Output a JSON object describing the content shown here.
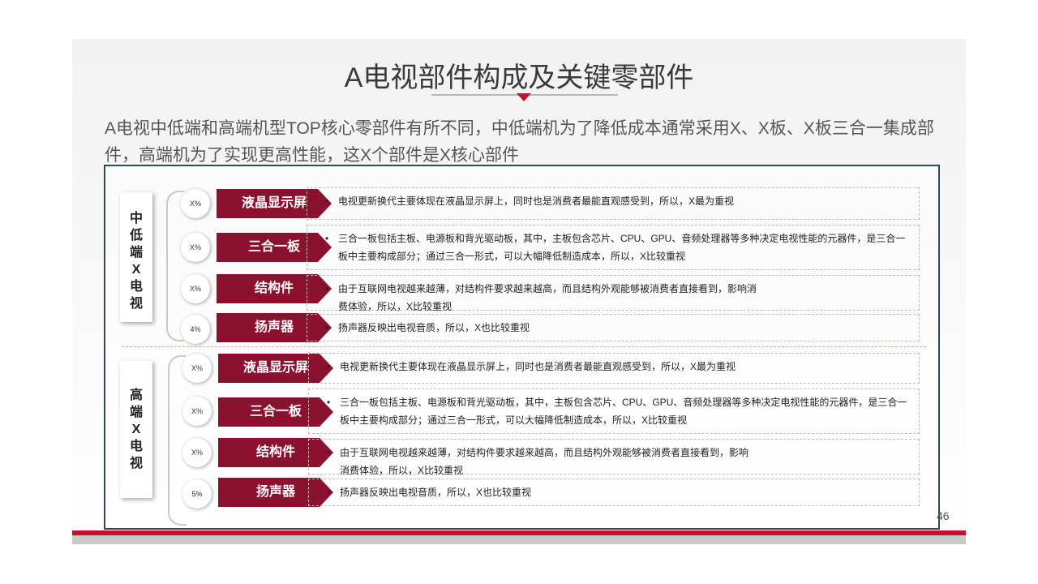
{
  "title": "A电视部件构成及关键零部件",
  "subtitle": "A电视中低端和高端机型TOP核心零部件有所不同，中低端机为了降低成本通常采用X、X板、X板三合一集成部件，高端机为了实现更高性能，这X个部件是X核心部件",
  "page_number": "46",
  "colors": {
    "accent": "#8c1030",
    "accent_bright": "#c8102e",
    "frame": "#2f4b53"
  },
  "groups": [
    {
      "label": "中低端X电视",
      "chars": [
        "中",
        "低",
        "端",
        "X",
        "电",
        "视"
      ],
      "rows": [
        {
          "pct": "X%",
          "label": "液晶显示屏",
          "bullet": "•",
          "text": "电视更新换代主要体现在液晶显示屏上，同时也是消费者最能直观感受到，所以，X最为重视"
        },
        {
          "pct": "X%",
          "label": "三合一板",
          "bullet": "•",
          "text": "三合一板包括主板、电源板和背光驱动板，其中，主板包含芯片、CPU、GPU、音频处理器等多种决定电视性能的元器件，是三合一板中主要构成部分；通过三合一形式，可以大幅降低制造成本，所以，X比较重视"
        },
        {
          "pct": "X%",
          "label": "结构件",
          "bullet": "•",
          "text": "由于互联网电视越来越薄，对结构件要求越来越高，而且结构外观能够被消费者直接看到，影响消费体验，所以，X比较重视"
        },
        {
          "pct": "4%",
          "label": "扬声器",
          "bullet": "•",
          "text": "扬声器反映出电视音质，所以，X也比较重视"
        }
      ]
    },
    {
      "label": "高端X电视",
      "chars": [
        "高",
        "端",
        "X",
        "电",
        "视"
      ],
      "rows": [
        {
          "pct": "X%",
          "label": "液晶显示屏",
          "bullet": "•",
          "text": "电视更新换代主要体现在液晶显示屏上，同时也是消费者最能直观感受到，所以，X最为重视"
        },
        {
          "pct": "X%",
          "label": "三合一板",
          "bullet": "•",
          "text": "三合一板包括主板、电源板和背光驱动板，其中，主板包含芯片、CPU、GPU、音频处理器等多种决定电视性能的元器件，是三合一板中主要构成部分；通过三合一形式，可以大幅降低制造成本，所以，X比较重视"
        },
        {
          "pct": "X%",
          "label": "结构件",
          "bullet": "•",
          "text": "由于互联网电视越来越薄，对结构件要求越来越高，而且结构外观能够被消费者直接看到，影响消费体验，所以，X比较重视"
        },
        {
          "pct": "5%",
          "label": "扬声器",
          "bullet": "•",
          "text": "扬声器反映出电视音质，所以，X也比较重视"
        }
      ]
    }
  ]
}
